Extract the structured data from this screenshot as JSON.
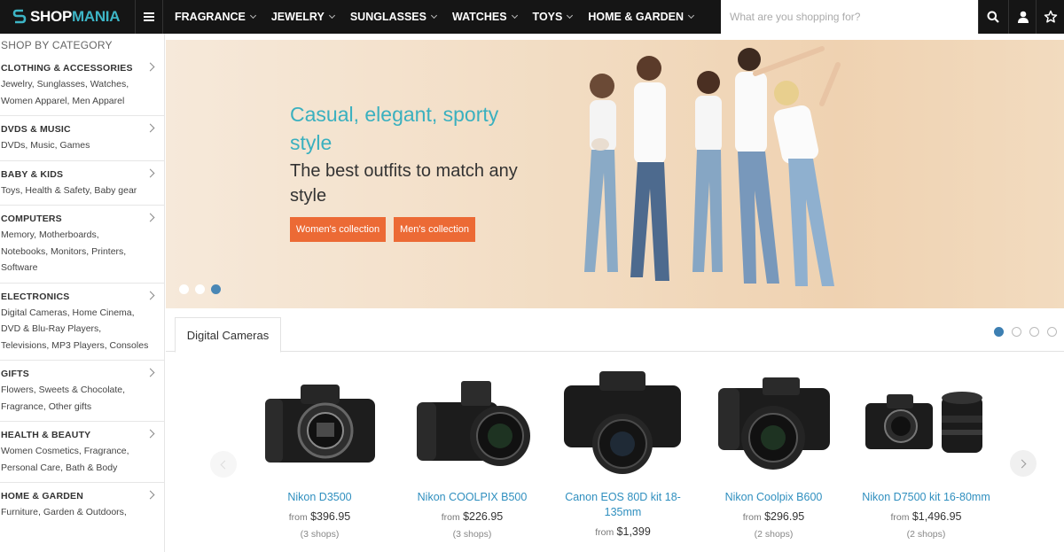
{
  "header": {
    "logo_prefix": "SHOP",
    "logo_suffix": "MANIA",
    "nav": [
      "FRAGRANCE",
      "JEWELRY",
      "SUNGLASSES",
      "WATCHES",
      "TOYS",
      "HOME & GARDEN"
    ],
    "search_placeholder": "What are you shopping for?",
    "icons": [
      "menu-icon",
      "search-icon",
      "user-icon",
      "star-icon"
    ]
  },
  "sidebar": {
    "title": "SHOP BY CATEGORY",
    "categories": [
      {
        "title": "CLOTHING & ACCESSORIES",
        "sub": [
          "Jewelry, Sunglasses, Watches,",
          "Women Apparel, Men Apparel"
        ]
      },
      {
        "title": "DVDS & MUSIC",
        "sub": [
          "DVDs, Music, Games"
        ]
      },
      {
        "title": "BABY & KIDS",
        "sub": [
          "Toys, Health & Safety, Baby gear"
        ]
      },
      {
        "title": "COMPUTERS",
        "sub": [
          "Memory, Motherboards,",
          "Notebooks, Monitors, Printers,",
          "Software"
        ]
      },
      {
        "title": "ELECTRONICS",
        "sub": [
          "Digital Cameras, Home Cinema,",
          "DVD & Blu-Ray Players,",
          "Televisions, MP3 Players, Consoles"
        ]
      },
      {
        "title": "GIFTS",
        "sub": [
          "Flowers, Sweets & Chocolate,",
          "Fragrance, Other gifts"
        ]
      },
      {
        "title": "HEALTH & BEAUTY",
        "sub": [
          "Women Cosmetics, Fragrance,",
          "Personal Care, Bath & Body"
        ]
      },
      {
        "title": "HOME & GARDEN",
        "sub": [
          "Furniture, Garden & Outdoors,"
        ]
      }
    ]
  },
  "banner": {
    "title": "Casual, elegant, sporty style",
    "subtitle": "The best outfits to match any style",
    "btn_women": "Women's collection",
    "btn_men": "Men's collection",
    "slides": 3,
    "active_slide": 3
  },
  "products": {
    "tab": "Digital Cameras",
    "pages": 4,
    "active_page": 1,
    "items": [
      {
        "name": "Nikon D3500",
        "from": "from",
        "price": "$396.95",
        "shops": "(3 shops)"
      },
      {
        "name": "Nikon COOLPIX B500",
        "from": "from",
        "price": "$226.95",
        "shops": "(3 shops)"
      },
      {
        "name": "Canon EOS 80D kit 18-135mm",
        "from": "from",
        "price": "$1,399",
        "shops": ""
      },
      {
        "name": "Nikon Coolpix B600",
        "from": "from",
        "price": "$296.95",
        "shops": "(2 shops)"
      },
      {
        "name": "Nikon D7500 kit 16-80mm",
        "from": "from",
        "price": "$1,496.95",
        "shops": "(2 shops)"
      }
    ]
  },
  "colors": {
    "topbar": "#151515",
    "accent_teal": "#3ab0bf",
    "button_orange": "#ec6a35",
    "link_blue": "#2f8fbf",
    "active_dot": "#4a87b5"
  }
}
